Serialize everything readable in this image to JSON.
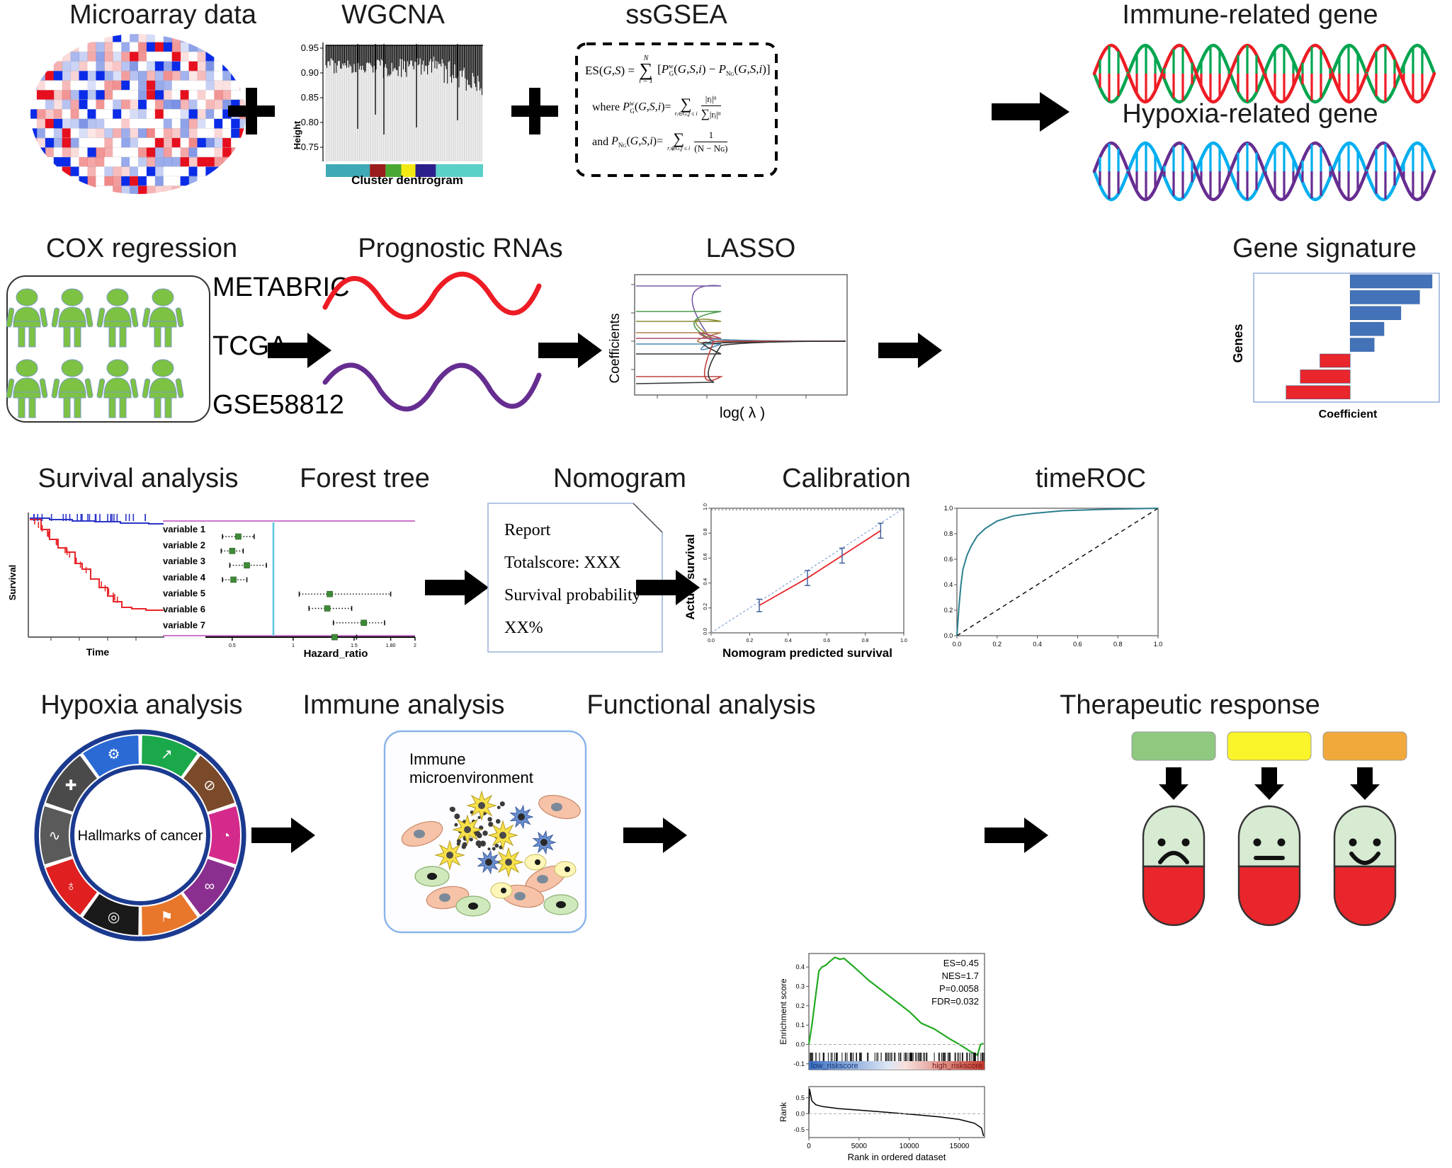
{
  "figure": {
    "type": "scientific-workflow-diagram",
    "rows": 4
  },
  "row1": {
    "titles": {
      "microarray": "Microarray data",
      "wgcna": "WGCNA",
      "ssgsea": "ssGSEA",
      "immune_gene": "Immune-related gene",
      "hypoxia_gene": "Hypoxia-related gene"
    },
    "wgcna_plot": {
      "ylabel": "Height",
      "xlabel": "Cluster dentrogram",
      "yticks": [
        "0.95",
        "0.90",
        "0.85",
        "0.80",
        "0.75"
      ],
      "module_colors": [
        "#3fa9b5",
        "#9a1c1c",
        "#4aa832",
        "#f2ea12",
        "#2b1f8c",
        "#5ad0c8"
      ]
    },
    "ssgsea_formula": {
      "line1": "ES(G,S) = ∑ [ Pᵂɢ(G,S,i) − Pₙɢ(G,S,i) ]",
      "sum_top": "N",
      "sum_bottom": "i = 1",
      "line2_prefix": "where",
      "line2_lhs": "Pᵂɢ(G,S,i) =",
      "line2_sub": "rⱼ∈G,j ≤ i",
      "line2_num": "|rⱼ|ᵅ",
      "line2_den_sum": "∑",
      "line2_den": "|rⱼ|ᵅ",
      "line2_den_sub": "rⱼ∈G",
      "line3_prefix": "and",
      "line3_lhs": "Pₙɢ(G,S,i) =",
      "line3_sub": "rⱼ∉G,j ≤ i",
      "line3_num": "1",
      "line3_den": "(N − Nɢ)"
    },
    "helix": {
      "immune_colors": [
        "#00a54f",
        "#ed1c24"
      ],
      "hypoxia_colors": [
        "#00aeef",
        "#662d91"
      ]
    }
  },
  "row2": {
    "titles": {
      "cox": "COX regression",
      "prognostic": "Prognostic RNAs",
      "lasso": "LASSO",
      "signature": "Gene signature"
    },
    "cohorts": [
      "METABRIC",
      "TCGA",
      "GSE58812"
    ],
    "people_count": 8,
    "people_color": "#7dc242",
    "rna_colors": {
      "top": "#ed1c24",
      "bottom": "#662d91"
    },
    "lasso_plot": {
      "ylabel": "Coefficients",
      "xlabel": "log( λ )",
      "series_colors": [
        "#7a5ba6",
        "#4a9a4a",
        "#8a8a33",
        "#b07d4a",
        "#b04a6a",
        "#4a8ab0",
        "#333333",
        "#c04040"
      ]
    },
    "signature_plot": {
      "ylabel": "Genes",
      "xlabel": "Coefficient",
      "type": "bar",
      "bars": [
        {
          "value": 0.92,
          "color": "#4472b8"
        },
        {
          "value": 0.78,
          "color": "#4472b8"
        },
        {
          "value": 0.57,
          "color": "#4472b8"
        },
        {
          "value": 0.38,
          "color": "#4472b8"
        },
        {
          "value": 0.27,
          "color": "#4472b8"
        },
        {
          "value": -0.34,
          "color": "#e8262b"
        },
        {
          "value": -0.56,
          "color": "#e8262b"
        },
        {
          "value": -0.72,
          "color": "#e8262b"
        }
      ]
    }
  },
  "row3": {
    "titles": {
      "survival": "Survival analysis",
      "forest": "Forest tree",
      "nomogram": "Nomogram",
      "calibration": "Calibration",
      "timeroc": "timeROC"
    },
    "survival_plot": {
      "ylabel": "Survival",
      "xlabel": "Time",
      "curve_colors": [
        "#2b35c8",
        "#e8262b"
      ]
    },
    "forest_plot": {
      "variables": [
        "variable 1",
        "variable 2",
        "variable 3",
        "variable 4",
        "variable 5",
        "variable 6",
        "variable 7"
      ],
      "xlabel": "Hazard_ratio",
      "xticks": [
        "0.5",
        "1",
        "1.5",
        "1.80",
        "2"
      ],
      "reference_line": 1,
      "marker_color": "#3d8b37",
      "rows": [
        {
          "hr": 0.55,
          "lo": 0.42,
          "hi": 0.68
        },
        {
          "hr": 0.5,
          "lo": 0.41,
          "hi": 0.59
        },
        {
          "hr": 0.62,
          "lo": 0.48,
          "hi": 0.78
        },
        {
          "hr": 0.51,
          "lo": 0.42,
          "hi": 0.62
        },
        {
          "hr": 1.3,
          "lo": 1.05,
          "hi": 1.8
        },
        {
          "hr": 1.28,
          "lo": 1.13,
          "hi": 1.48
        },
        {
          "hr": 1.58,
          "lo": 1.33,
          "hi": 1.75
        },
        {
          "hr": 1.34,
          "lo": 1.33,
          "hi": 1.52
        }
      ]
    },
    "nomogram_card": {
      "line1": "Report",
      "line2": "Totalscore: XXX",
      "line3": "Survival probability",
      "line4": "XX%"
    },
    "calibration_plot": {
      "xlabel": "Nomogram predicted survival",
      "ylabel": "Actual survival",
      "xticks": [
        "0.0",
        "0.2",
        "0.4",
        "0.6",
        "0.8",
        "1.0"
      ],
      "yticks": [
        "0.0",
        "0.2",
        "0.4",
        "0.6",
        "0.8",
        "1.0"
      ],
      "points": [
        {
          "x": 0.25,
          "y": 0.22,
          "err": 0.05
        },
        {
          "x": 0.5,
          "y": 0.44,
          "err": 0.06
        },
        {
          "x": 0.68,
          "y": 0.62,
          "err": 0.06
        },
        {
          "x": 0.88,
          "y": 0.82,
          "err": 0.06
        }
      ],
      "line_color": "#e8262b",
      "ref_color": "#8aa8d8"
    },
    "roc_plot": {
      "xticks": [
        "0.0",
        "0.2",
        "0.4",
        "0.6",
        "0.8",
        "1.0"
      ],
      "yticks": [
        "0.0",
        "0.2",
        "0.4",
        "0.6",
        "0.8",
        "1.0"
      ],
      "curve_color": "#2b7f8f"
    }
  },
  "row4": {
    "titles": {
      "hypoxia": "Hypoxia analysis",
      "immune": "Immune analysis",
      "functional": "Functional analysis",
      "therapeutic": "Therapeutic response"
    },
    "hallmarks": {
      "center_label": "Hallmarks of cancer",
      "ring_color": "#1b3a8f",
      "segments": [
        {
          "color": "#1aa84a",
          "icon": "arrow-growth-icon"
        },
        {
          "color": "#7b4a2a",
          "icon": "no-entry-icon"
        },
        {
          "color": "#d42a8c",
          "icon": "flame-swirl-icon"
        },
        {
          "color": "#8a2f8f",
          "icon": "infinity-icon"
        },
        {
          "color": "#e8762b",
          "icon": "fire-icon"
        },
        {
          "color": "#1a1a1a",
          "icon": "cell-icon"
        },
        {
          "color": "#e02020",
          "icon": "dna-loop-icon"
        },
        {
          "color": "#5a5a5a",
          "icon": "wave-icon"
        },
        {
          "color": "#4a4a4a",
          "icon": "cross-icon"
        },
        {
          "color": "#2b6ad4",
          "icon": "gear-icon"
        }
      ]
    },
    "immune_box": {
      "label_line1": "Immune",
      "label_line2": "microenvironment",
      "border_color": "#8ab4e8"
    },
    "gsea_plot": {
      "ylabel_top": "Enrichment score",
      "ylabel_bottom": "Rank",
      "xlabel": "Rank in ordered dataset",
      "xticks": [
        "0",
        "5000",
        "10000",
        "15000"
      ],
      "yticks_top": [
        "-0.1",
        "0.0",
        "0.1",
        "0.2",
        "0.3",
        "0.4"
      ],
      "yticks_bottom": [
        "-0.5",
        "0.0",
        "0.5"
      ],
      "stats": [
        "ES=0.45",
        "NES=1.7",
        "P=0.0058",
        "FDR=0.032"
      ],
      "band_low_label": "low_riskscore",
      "band_high_label": "high_riskscore",
      "curve_color": "#22aa22"
    },
    "therapeutic": {
      "bars": [
        {
          "color": "#8ec97f"
        },
        {
          "color": "#faf42a"
        },
        {
          "color": "#f2a93b"
        }
      ],
      "pills": [
        {
          "face": "sad",
          "top_color": "#d7ead2",
          "bottom_color": "#e8262b"
        },
        {
          "face": "neutral",
          "top_color": "#d7ead2",
          "bottom_color": "#e8262b"
        },
        {
          "face": "happy",
          "top_color": "#d7ead2",
          "bottom_color": "#e8262b"
        }
      ]
    }
  },
  "arrows": {
    "count": 9,
    "color": "#000000"
  }
}
